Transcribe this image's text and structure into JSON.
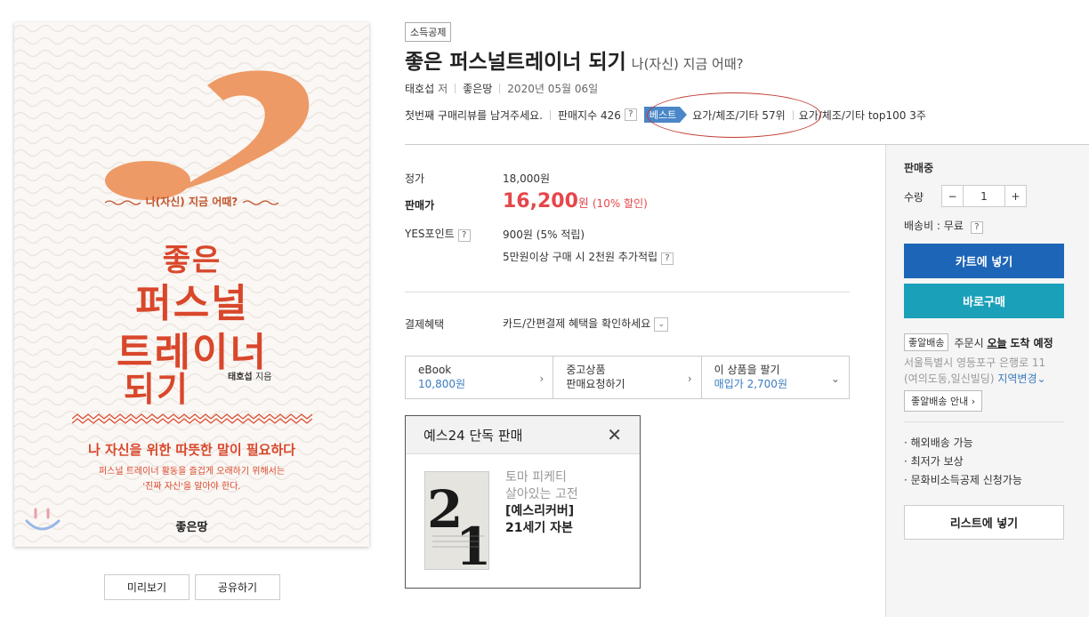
{
  "cover": {
    "subtitle": "나(자신) 지금 어때?",
    "title_lines": [
      "좋은",
      "퍼스널",
      "트레이너",
      "되기"
    ],
    "author": "태호섭",
    "author_suffix": "지음",
    "tagline": "나 자신을 위한 따뜻한 말이 필요하다",
    "desc_line1": "퍼스널 트레이너 활동을 즐겁게 오래하기 위해서는",
    "desc_line2": "'진짜 자신'을 알아야 한다.",
    "publisher": "좋은땅",
    "preview_label": "미리보기",
    "share_label": "공유하기"
  },
  "product": {
    "tag": "소득공제",
    "title": "좋은 퍼스널트레이너 되기",
    "subtitle": "나(자신) 지금 어때?",
    "author": "태호섭",
    "author_role": "저",
    "publisher": "좋은땅",
    "date": "2020년 05월 06일",
    "review_prompt": "첫번째 구매리뷰를 남겨주세요.",
    "sales_index": "판매지수 426",
    "best_label": "베스트",
    "rank1": "요가/체조/기타 57위",
    "rank2": "요가/체조/기타 top100 3주",
    "help": "?"
  },
  "price": {
    "list_label": "정가",
    "list_value": "18,000원",
    "sale_label": "판매가",
    "sale_value": "16,200",
    "sale_unit": "원",
    "discount": "(10% 할인)",
    "point_label": "YES포인트",
    "point_value": "900원 (5% 적립)",
    "extra_point": "5만원이상 구매 시 2천원 추가적립",
    "pay_label": "결제혜택",
    "pay_value": "카드/간편결제 혜택을 확인하세요"
  },
  "options": [
    {
      "line1": "eBook",
      "line2": "10,800원"
    },
    {
      "line1": "중고상품",
      "line2": "판매요청하기"
    },
    {
      "line1": "이 상품을 팔기",
      "line2": "매입가 2,700원"
    }
  ],
  "exclusive": {
    "header": "예스24 단독 판매",
    "author": "토마 피케티",
    "tag": "살아있는 고전",
    "edition": "[예스리커버]",
    "book_title": "21세기 자본"
  },
  "sidebar": {
    "status": "판매중",
    "qty_label": "수량",
    "qty_value": "1",
    "minus": "−",
    "plus": "+",
    "shipping": "배송비 : 무료",
    "cart_label": "카트에 넣기",
    "buy_label": "바로구매",
    "delivery_chip": "좋알배송",
    "delivery_pre": "주문시",
    "delivery_today": "오늘",
    "delivery_post": "도착 예정",
    "addr_line1": "서울특별시 영등포구 은행로 11",
    "addr_line2": "(여의도동,일신빌딩)",
    "change_region": "지역변경",
    "guide_label": "좋알배송 안내",
    "benefits": [
      "· 해외배송 가능",
      "· 최저가 보상",
      "· 문화비소득공제 신청가능"
    ],
    "list_label": "리스트에 넣기"
  },
  "colors": {
    "accent_red": "#e5474b",
    "cart_blue": "#1d65b6",
    "buy_teal": "#1aa0b8",
    "best_blue": "#4a86c8",
    "cover_orange": "#ee9a66",
    "cover_title": "#d9472b"
  }
}
